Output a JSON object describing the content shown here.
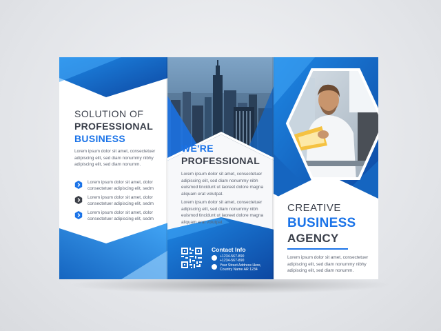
{
  "panel_left": {
    "title_line1": "SOLUTION OF",
    "title_line2": "PROFESSIONAL",
    "title_line3": "BUSINESS",
    "intro": "Lorem ipsum dolor sit amet, consectetuer adipiscing elit, sed diam nonummy nibhy adipiscing elit, sed diam nonumm.",
    "bullets": [
      "Lorem ipsum dolor sit amet, dolor consectetuer adipiscing elit, sedm",
      "Lorem ipsum dolor sit amet, dolor consectetuer adipiscing elit, sedm",
      "Lorem ipsum dolor sit amet, dolor consectetuer adipiscing elit, sedm"
    ]
  },
  "panel_middle": {
    "title_line1": "WE'RE",
    "title_line2": "PROFESSIONAL",
    "para1": "Lorem ipsum dolor sit amet, consectetuer adipiscing elit, sed diam nonummy nibh euismod tincidunt ut laoreet dolore magna aliquam erat volutpat.",
    "para2": "Lorem ipsum dolor sit amet, consectetuer adipiscing elit, sed diam nonummy nibh euismod tincidunt ut laoreet dolore magna aliquam erat volutpat.",
    "contact": {
      "title": "Contact Info",
      "phone1": "+1234-567-890",
      "phone2": "+1234-567-890",
      "address1": "Your Street Address Here,",
      "address2": "Country Name AR 1234"
    }
  },
  "panel_right": {
    "title_line1": "CREATIVE",
    "title_line2": "BUSINESS",
    "title_line3": "AGENCY",
    "para": "Lorem ipsum dolor sit amet, consectetuer adipiscing elit, sed diam nonummy nibhy adipiscing elit, sed diam nonumm."
  },
  "colors": {
    "accent_blue": "#1a73e8",
    "dark_blue": "#0d47a1",
    "light_blue": "#42a5f5",
    "text_dark": "#3a3f4a"
  },
  "icons": {
    "bullet1": "chevron-right-icon",
    "bullet2": "chevron-right-icon",
    "bullet3": "chevron-right-icon",
    "qr": "qr-code-icon",
    "phone": "phone-icon",
    "location": "location-pin-icon"
  }
}
